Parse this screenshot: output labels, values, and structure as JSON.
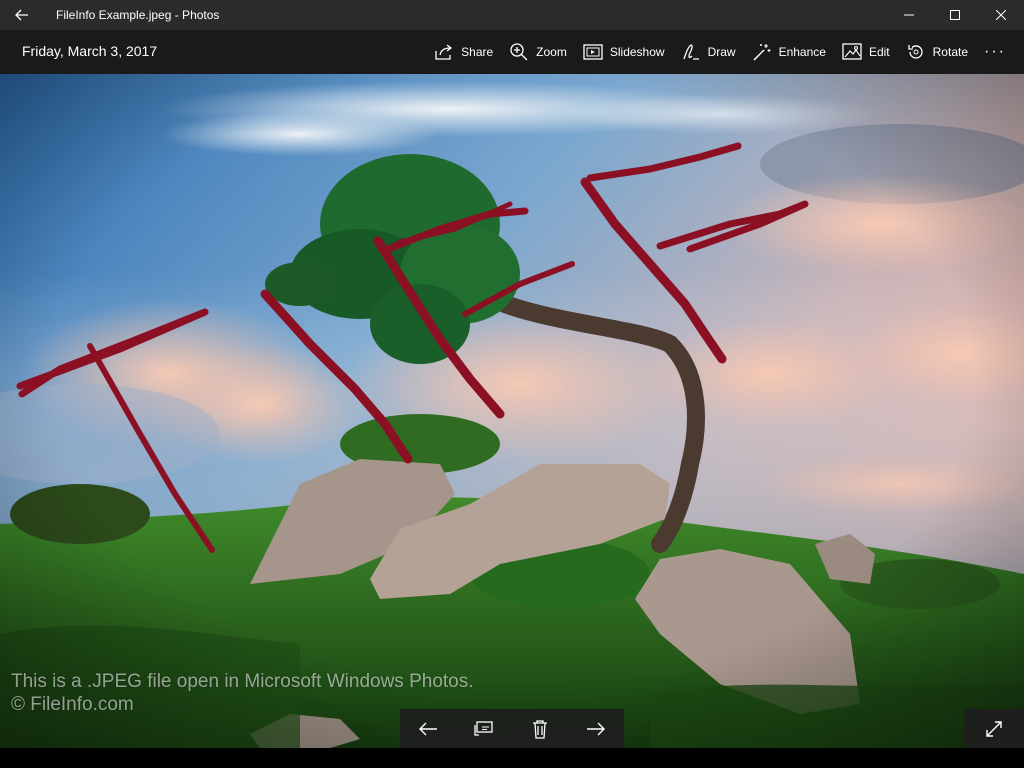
{
  "window": {
    "title": "FileInfo Example.jpeg - Photos"
  },
  "toolbar": {
    "date": "Friday, March 3, 2017",
    "commands": [
      {
        "label": "Share",
        "icon": "share-icon"
      },
      {
        "label": "Zoom",
        "icon": "zoom-icon"
      },
      {
        "label": "Slideshow",
        "icon": "slideshow-icon"
      },
      {
        "label": "Draw",
        "icon": "draw-icon"
      },
      {
        "label": "Enhance",
        "icon": "enhance-icon"
      },
      {
        "label": "Edit",
        "icon": "edit-icon"
      },
      {
        "label": "Rotate",
        "icon": "rotate-icon"
      }
    ],
    "more": "···"
  },
  "photo": {
    "caption_line1": "This is a .JPEG file open in Microsoft Windows Photos.",
    "caption_line2": "© FileInfo.com",
    "ink_color": "#8b1024"
  },
  "bottom_controls": [
    "previous-icon",
    "add-to-album-icon",
    "delete-icon",
    "next-icon"
  ],
  "colors": {
    "titlebar": "#2b2b2b",
    "appbar": "#1a1a1a"
  }
}
